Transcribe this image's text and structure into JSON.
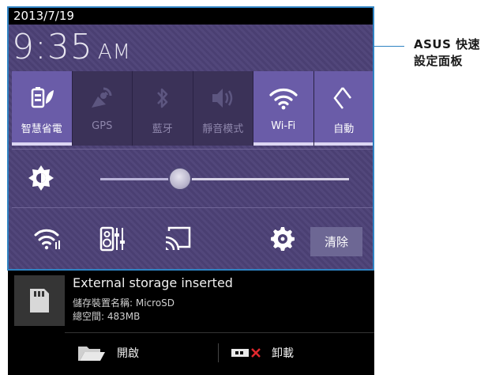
{
  "status_bar": {
    "date": "2013/7/19"
  },
  "clock": {
    "time": "9:35",
    "ampm": "AM"
  },
  "toggles": [
    {
      "label": "智慧省電",
      "icon": "power-saver-icon",
      "state": "on"
    },
    {
      "label": "GPS",
      "icon": "gps-icon",
      "state": "off"
    },
    {
      "label": "藍牙",
      "icon": "bluetooth-icon",
      "state": "off"
    },
    {
      "label": "靜音模式",
      "icon": "mute-icon",
      "state": "off"
    },
    {
      "label": "Wi-Fi",
      "icon": "wifi-icon",
      "state": "on"
    },
    {
      "label": "自動",
      "icon": "auto-rotate-icon",
      "state": "on"
    }
  ],
  "brightness": {
    "level": 0.32
  },
  "shortcuts": {
    "clear_label": "清除",
    "icons": [
      "wifi-settings-icon",
      "audio-wizard-icon",
      "screen-cast-icon",
      "settings-gear-icon"
    ]
  },
  "notification": {
    "title": "External storage inserted",
    "line1": "儲存裝置名稱: MicroSD",
    "line2": "總空間: 483MB",
    "open_label": "開啟",
    "unmount_label": "卸載"
  },
  "annotation": {
    "line1": "ASUS 快速",
    "line2": "設定面板"
  },
  "colors": {
    "panel": "#4a3f72",
    "toggle_on": "#6a5ca8",
    "highlight": "#2f83c3"
  }
}
